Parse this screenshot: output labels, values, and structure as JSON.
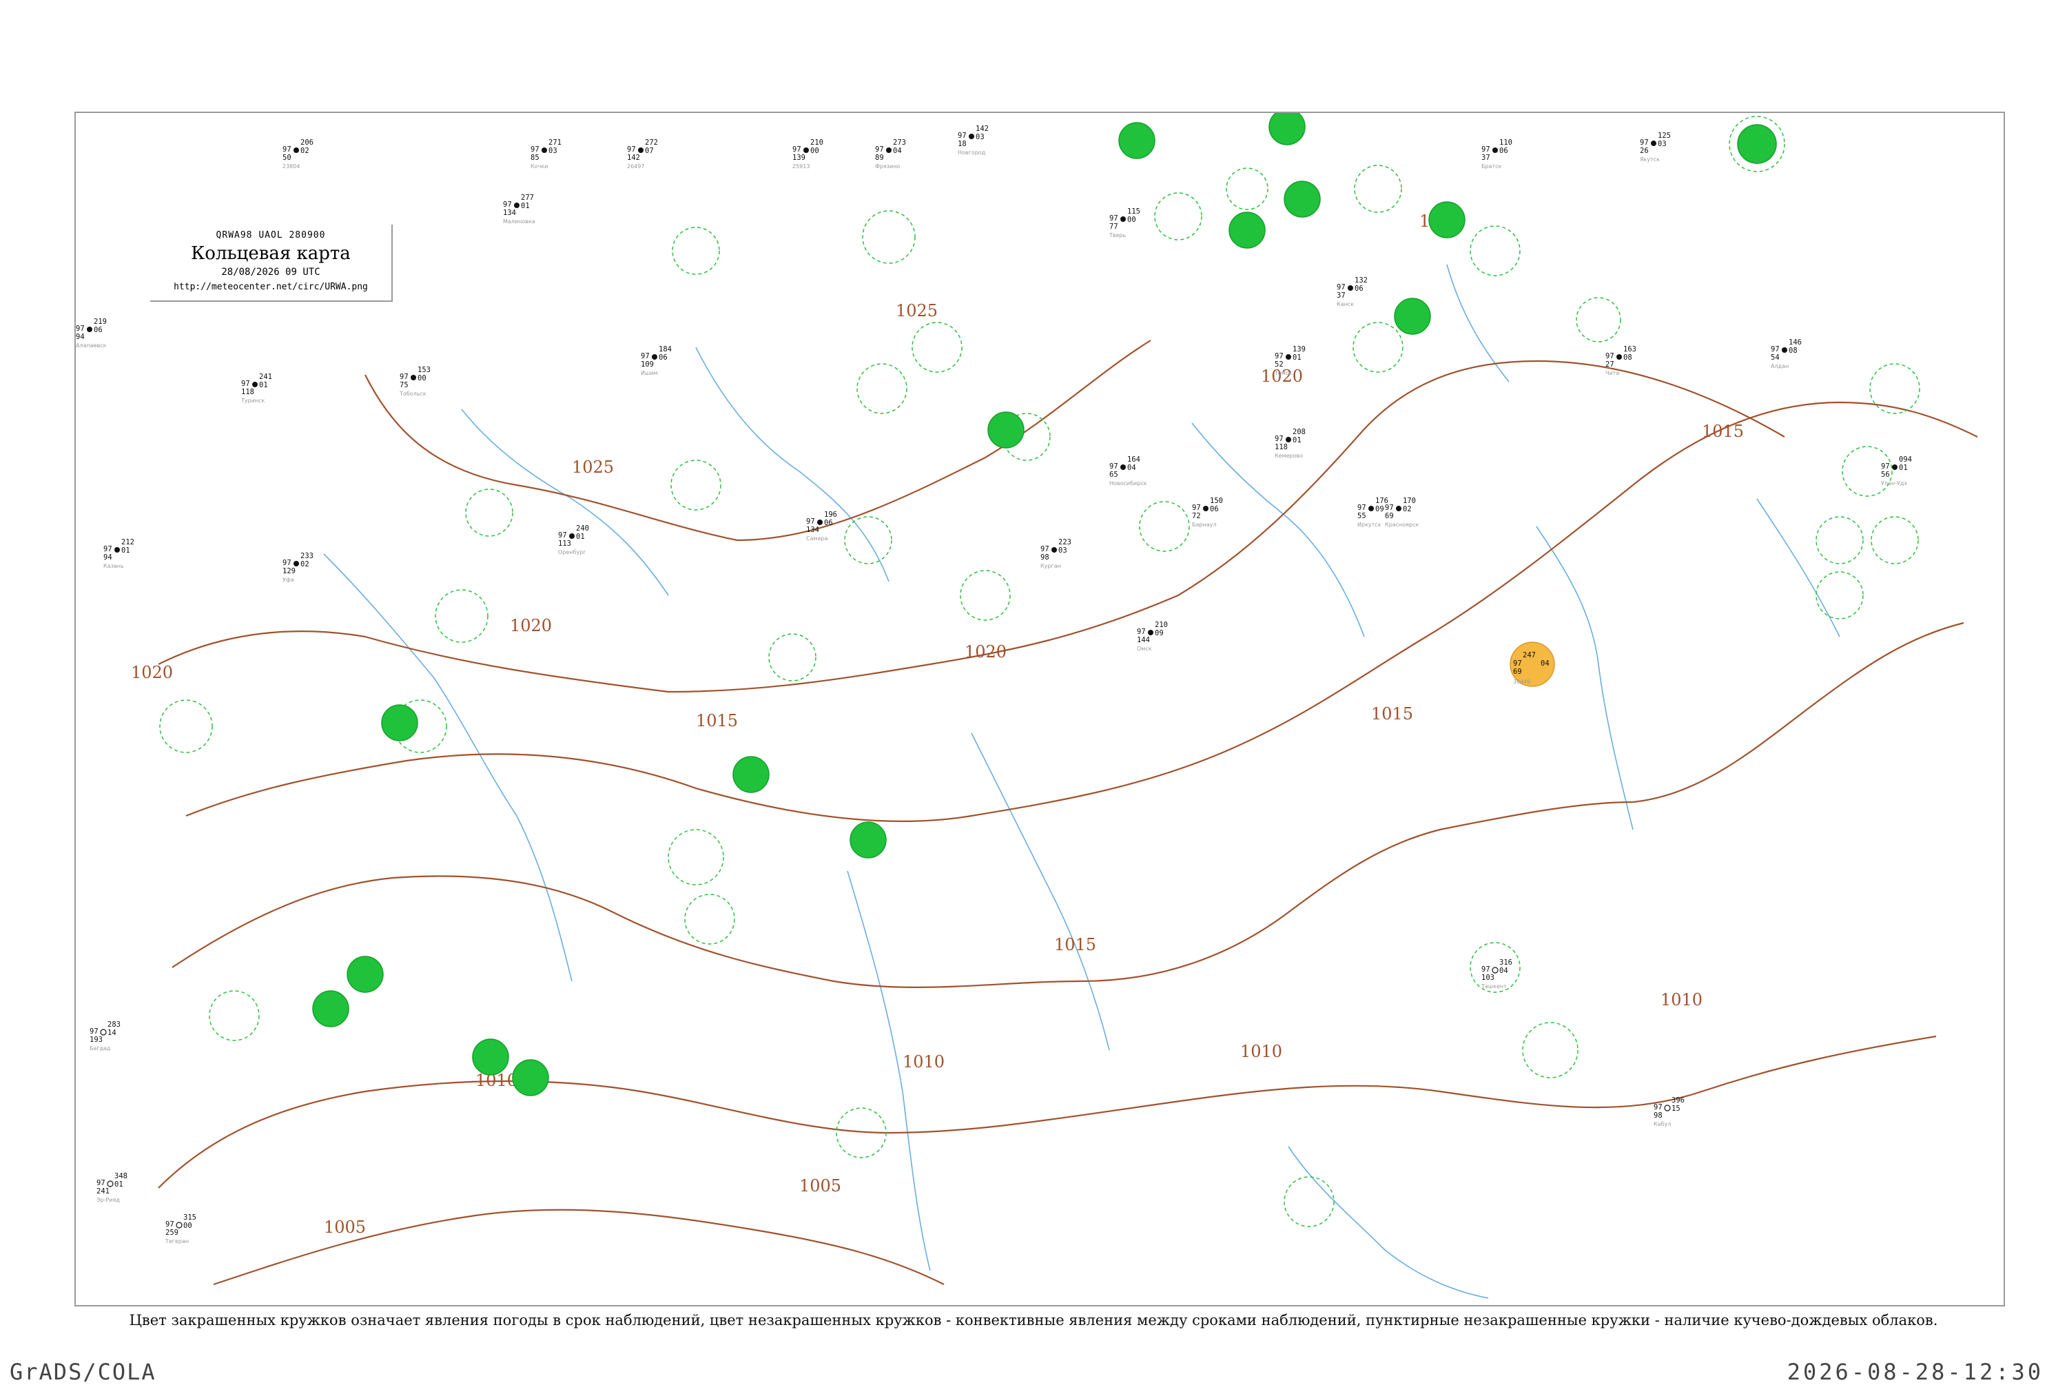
{
  "header": {
    "code": "QRWA98  UAOL  280900",
    "title": "Кольцевая карта",
    "date": "28/08/2026 09 UTC",
    "url": "http://meteocenter.net/circ/URWA.png"
  },
  "caption": "Цвет закрашенных кружков означает явления погоды в срок наблюдений, цвет незакрашенных кружков - конвективные явления между сроками наблюдений, пунктирные незакрашенные кружки - наличие кучево-дождевых облаков.",
  "footer": {
    "left": "GrADS/COLA",
    "right": "2026-08-28-12:30"
  },
  "colors": {
    "isobar": "#a0522d",
    "river": "#6aaedf",
    "precip_fill": "#1fc23a",
    "dust_fill": "#f5b942",
    "cb_circle": "#2fbf3f",
    "frame": "#9a9a9a"
  },
  "isobars": [
    {
      "value": "1025"
    },
    {
      "value": "1020"
    },
    {
      "value": "1015"
    },
    {
      "value": "1010"
    },
    {
      "value": "1005"
    }
  ],
  "stations": [
    {
      "pressure": "206",
      "temp": "97",
      "dew": "50",
      "tend": "02",
      "name": "23804"
    },
    {
      "pressure": "271",
      "temp": "97",
      "dew": "85",
      "tend": "03",
      "name": "Кочки"
    },
    {
      "pressure": "277",
      "temp": "97",
      "dew": "134",
      "tend": "01",
      "name": "Малиновка"
    },
    {
      "pressure": "272",
      "temp": "97",
      "dew": "142",
      "tend": "07",
      "name": "26497"
    },
    {
      "pressure": "210",
      "temp": "97",
      "dew": "139",
      "tend": "00",
      "name": "25913"
    },
    {
      "pressure": "273",
      "temp": "97",
      "dew": "89",
      "tend": "04",
      "name": "Фрязино"
    },
    {
      "pressure": "142",
      "temp": "97",
      "dew": "18",
      "tend": "03",
      "name": "Новгород"
    },
    {
      "pressure": "115",
      "temp": "97",
      "dew": "77",
      "tend": "00",
      "name": "Тверь"
    },
    {
      "pressure": "219",
      "temp": "97",
      "dew": "94",
      "tend": "06",
      "name": "Алапаевск"
    },
    {
      "pressure": "241",
      "temp": "97",
      "dew": "118",
      "tend": "01",
      "name": "Туринск"
    },
    {
      "pressure": "153",
      "temp": "97",
      "dew": "75",
      "tend": "00",
      "name": "Тобольск"
    },
    {
      "pressure": "184",
      "temp": "97",
      "dew": "109",
      "tend": "06",
      "name": "Ишим"
    },
    {
      "pressure": "212",
      "temp": "97",
      "dew": "94",
      "tend": "01",
      "name": "Казань"
    },
    {
      "pressure": "233",
      "temp": "97",
      "dew": "129",
      "tend": "02",
      "name": "Уфа"
    },
    {
      "pressure": "240",
      "temp": "97",
      "dew": "113",
      "tend": "01",
      "name": "Оренбург"
    },
    {
      "pressure": "196",
      "temp": "97",
      "dew": "134",
      "tend": "06",
      "name": "Самара"
    },
    {
      "pressure": "223",
      "temp": "97",
      "dew": "98",
      "tend": "03",
      "name": "Курган"
    },
    {
      "pressure": "210",
      "temp": "97",
      "dew": "144",
      "tend": "09",
      "name": "Омск"
    },
    {
      "pressure": "164",
      "temp": "97",
      "dew": "65",
      "tend": "04",
      "name": "Новосибирск"
    },
    {
      "pressure": "150",
      "temp": "97",
      "dew": "72",
      "tend": "06",
      "name": "Барнаул"
    },
    {
      "pressure": "208",
      "temp": "97",
      "dew": "118",
      "tend": "01",
      "name": "Кемерово"
    },
    {
      "pressure": "139",
      "temp": "97",
      "dew": "52",
      "tend": "01",
      "name": "Томск"
    },
    {
      "pressure": "170",
      "temp": "97",
      "dew": "69",
      "tend": "02",
      "name": "Красноярск"
    },
    {
      "pressure": "132",
      "temp": "97",
      "dew": "37",
      "tend": "06",
      "name": "Канск"
    },
    {
      "pressure": "176",
      "temp": "97",
      "dew": "55",
      "tend": "09",
      "name": "Иркутск"
    },
    {
      "pressure": "110",
      "temp": "97",
      "dew": "37",
      "tend": "06",
      "name": "Братск"
    },
    {
      "pressure": "163",
      "temp": "97",
      "dew": "27",
      "tend": "08",
      "name": "Чита"
    },
    {
      "pressure": "125",
      "temp": "97",
      "dew": "26",
      "tend": "03",
      "name": "Якутск"
    },
    {
      "pressure": "146",
      "temp": "97",
      "dew": "54",
      "tend": "08",
      "name": "Алдан"
    },
    {
      "pressure": "094",
      "temp": "97",
      "dew": "56",
      "tend": "01",
      "name": "Улан-Удэ"
    },
    {
      "pressure": "247",
      "temp": "97",
      "dew": "69",
      "tend": "04",
      "name": "38446"
    },
    {
      "pressure": "316",
      "temp": "97",
      "dew": "103",
      "tend": "04",
      "name": "Ташкент"
    },
    {
      "pressure": "396",
      "temp": "97",
      "dew": "98",
      "tend": "15",
      "name": "Кабул"
    },
    {
      "pressure": "315",
      "temp": "97",
      "dew": "259",
      "tend": "00",
      "name": "Тегеран"
    },
    {
      "pressure": "283",
      "temp": "97",
      "dew": "193",
      "tend": "14",
      "name": "Багдад"
    },
    {
      "pressure": "348",
      "temp": "97",
      "dew": "241",
      "tend": "01",
      "name": "Эр-Рияд"
    }
  ]
}
